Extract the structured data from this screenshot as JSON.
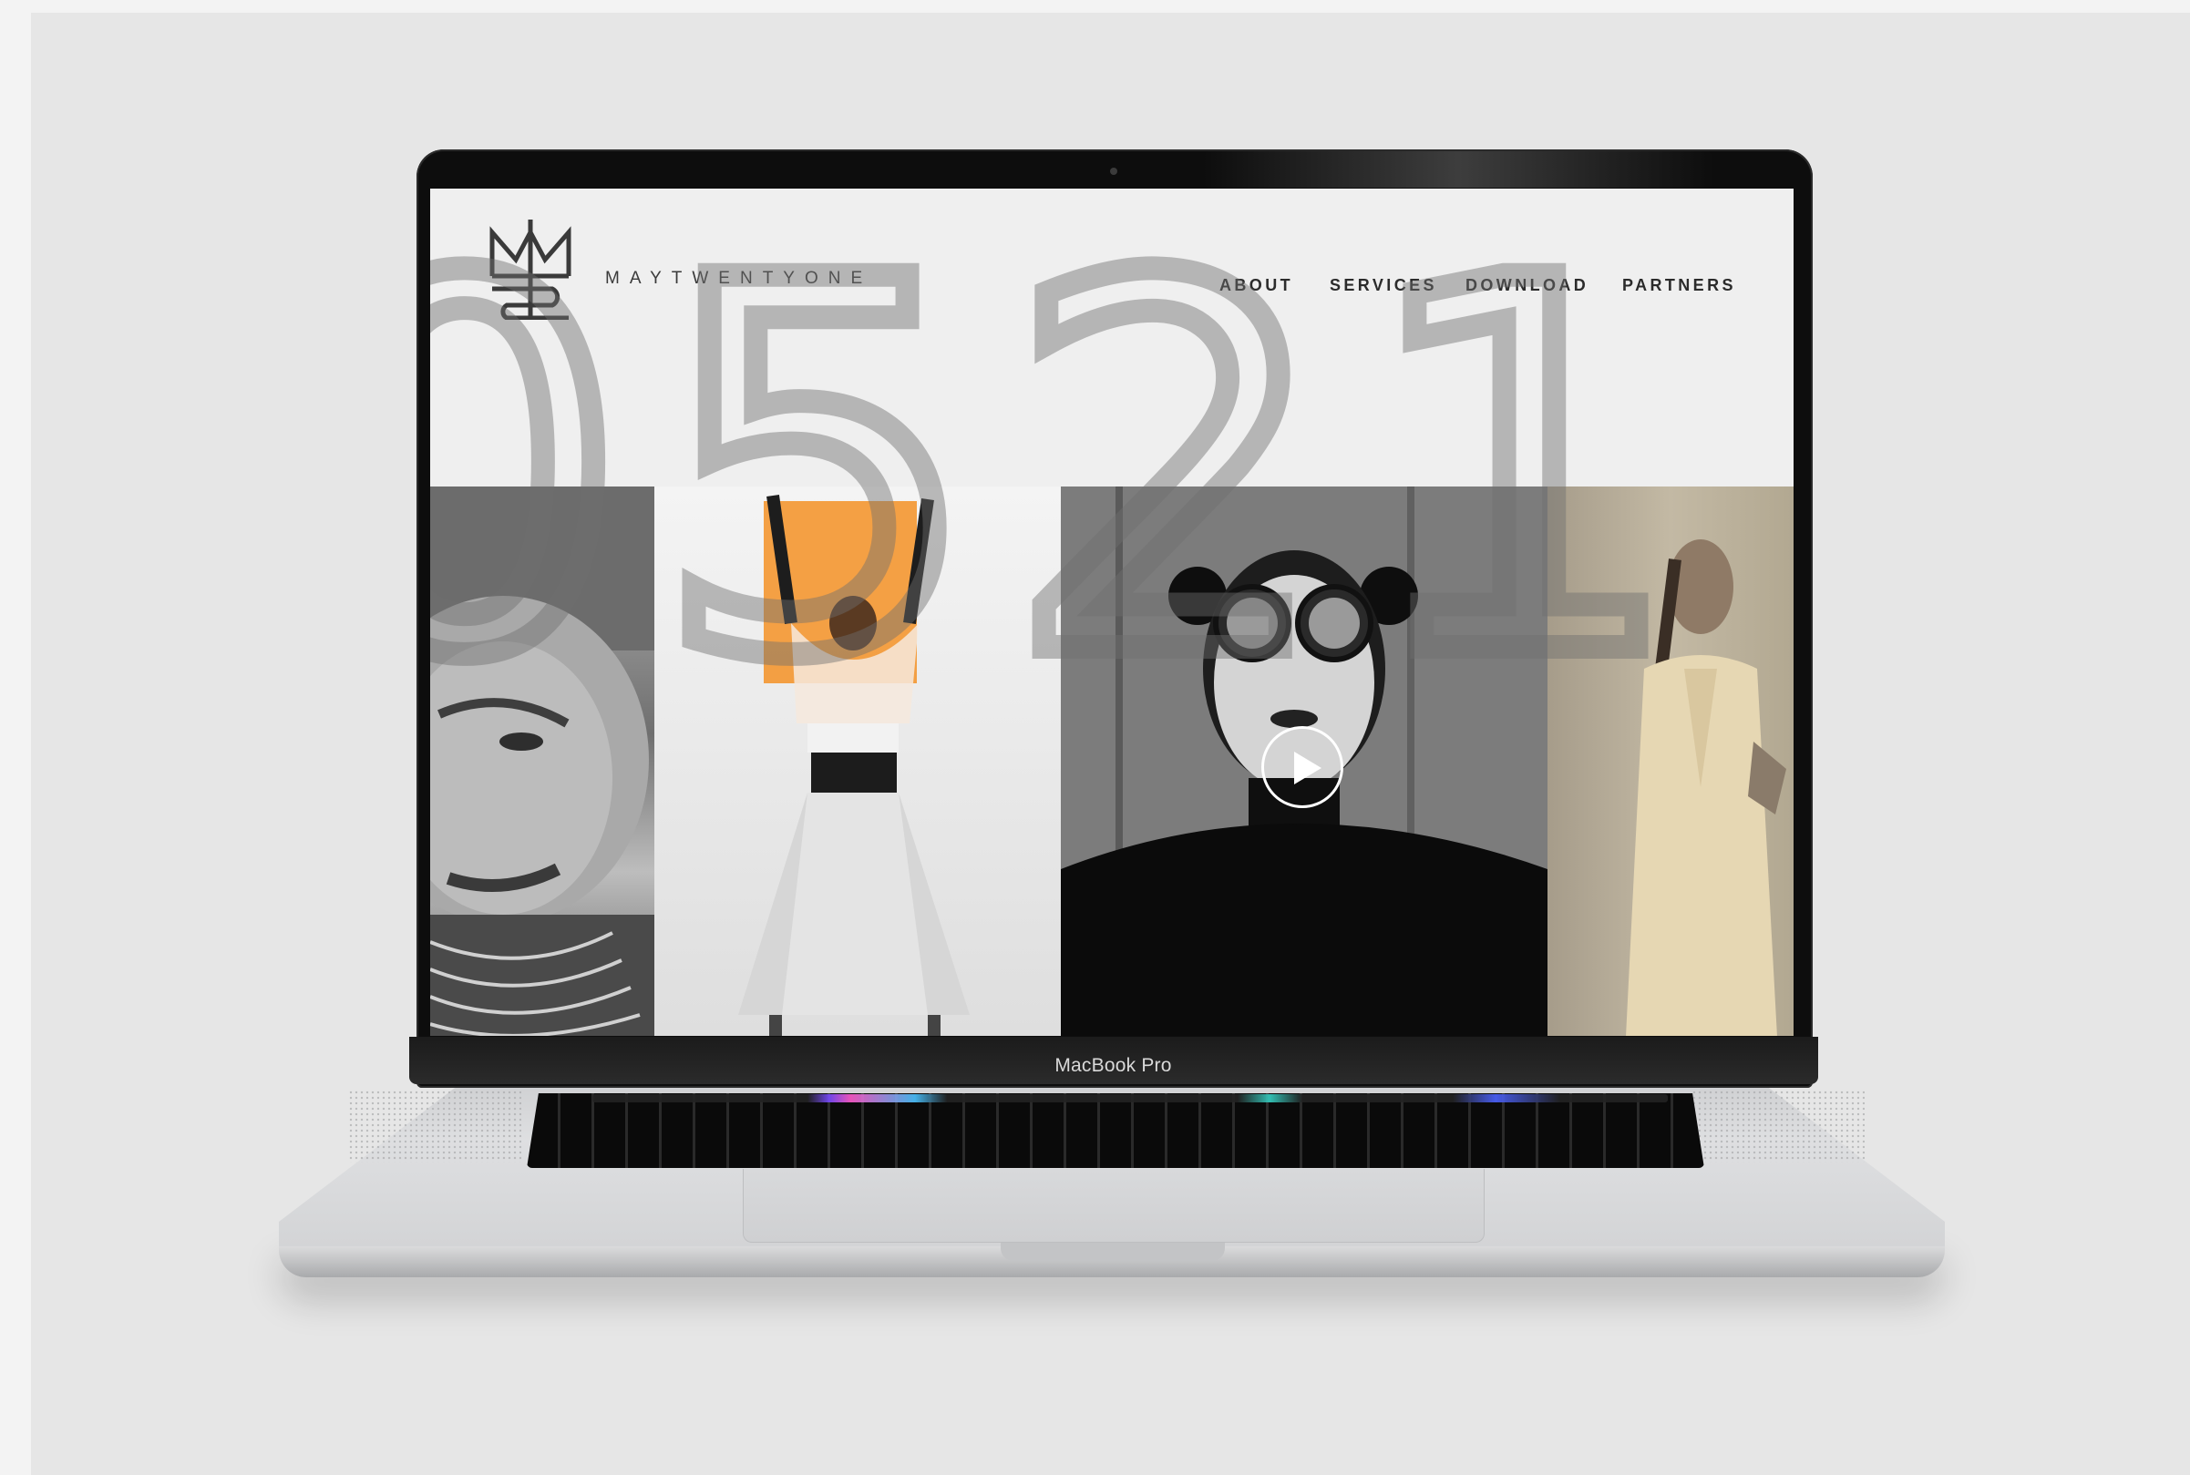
{
  "site": {
    "brand": "MAYTWENTYONE",
    "nav": {
      "about": "ABOUT",
      "services": "SERVICES",
      "download": "DOWNLOAD",
      "partners": "PARTNERS"
    },
    "hero_number": "0521"
  },
  "device": {
    "label": "MacBook Pro"
  },
  "colors": {
    "screen_bg": "#efefef",
    "accent_orange": "#f39b3a",
    "text_dark": "#2b2b2b",
    "page_bg": "#e6e6e6"
  },
  "icons": [
    "brand-logo-icon",
    "play-icon"
  ]
}
